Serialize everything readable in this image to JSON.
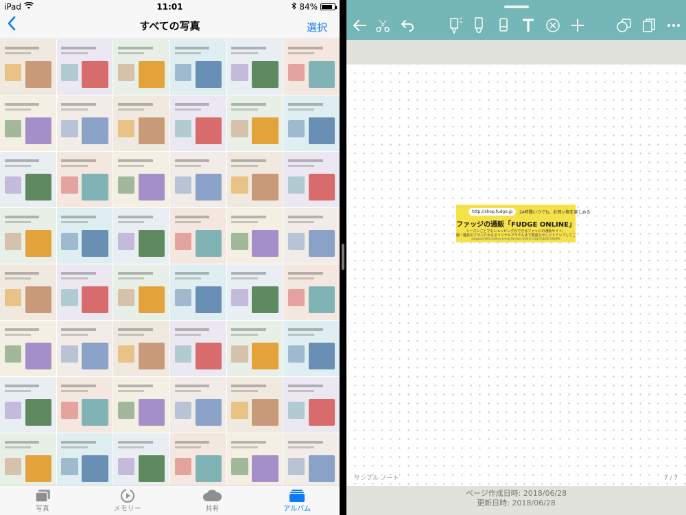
{
  "status_bar": {
    "device": "iPad",
    "time": "11:01",
    "battery_text": "84%",
    "battery_level": 0.84,
    "icons": [
      "wifi-icon",
      "bluetooth-icon",
      "battery-icon"
    ]
  },
  "photos": {
    "back_icon": "chevron-left-icon",
    "title": "すべての写真",
    "select_label": "選択",
    "accent": "#0a7aff",
    "thumbnail_palette": [
      "#efe9df",
      "#dfeef0",
      "#f4efe3",
      "#ece8f2",
      "#e9eef2",
      "#f1ece7",
      "#e7efe7",
      "#f4e7df"
    ],
    "thumbnail_accents": [
      "#c89a7a",
      "#7fb3b6",
      "#e4a33a",
      "#8aa2c8",
      "#5f8a5f",
      "#d86b6b",
      "#a58fc9",
      "#6a8fb5"
    ],
    "thumbnail_count": 48,
    "tabs": [
      {
        "label": "写真",
        "icon": "photos-stack-icon",
        "active": false
      },
      {
        "label": "メモリー",
        "icon": "memories-play-icon",
        "active": false
      },
      {
        "label": "共有",
        "icon": "cloud-icon",
        "active": false
      },
      {
        "label": "アルバム",
        "icon": "album-folder-icon",
        "active": true
      }
    ]
  },
  "notes": {
    "toolbar_color": "#75b6b6",
    "toolbar_icons": [
      "back-arrow-icon",
      "scissors-icon",
      "undo-icon",
      "pen-icon",
      "marker-icon",
      "eraser-icon",
      "text-tool-icon",
      "clear-icon",
      "add-icon",
      "shapes-icon",
      "pages-icon",
      "more-icon"
    ],
    "notebook_name": "サンプル ノート",
    "page_count": "7 / 7",
    "banner": {
      "url_text": "http://shop.fudge.jp",
      "tagline": "24時間いつでも、お買い物を楽しめる",
      "headline": "ファッジの通販「FUDGE ONLINE」",
      "sub_line_1": "シーズンごとでもショッピングができるファッジの通販サイト。",
      "sub_line_2": "服・雑貨のブランドからオリジナルアイテムまで豊富なセレクトアップしてご紹介！",
      "sub_line_3": "polyglott Web Gallery Living Fashion Online shop FUDGE ONLINE",
      "color": "#f5e14a"
    },
    "created_label": "ページ作成日時: 2018/06/28",
    "updated_label": "更新日時: 2018/06/28"
  }
}
